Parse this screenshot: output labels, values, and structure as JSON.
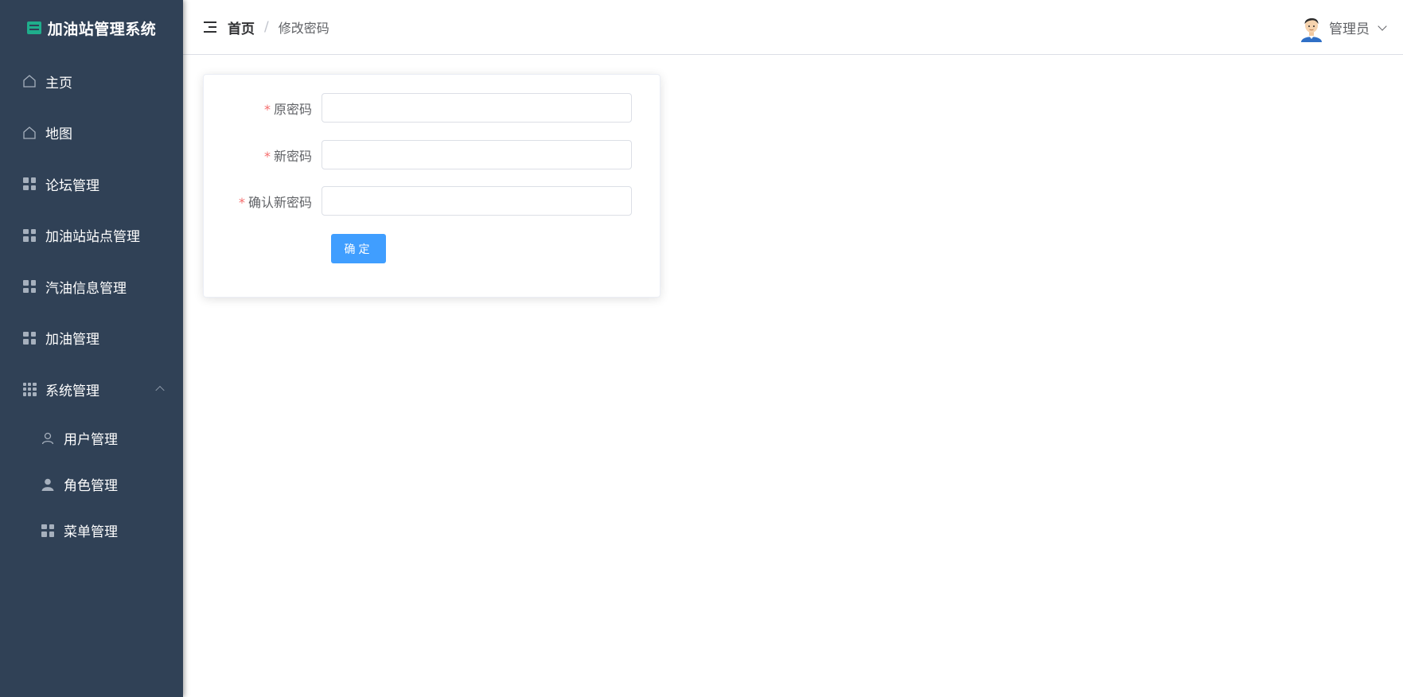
{
  "app": {
    "title": "加油站管理系统"
  },
  "sidebar": {
    "items": [
      {
        "label": "主页",
        "icon": "home-icon"
      },
      {
        "label": "地图",
        "icon": "home-icon"
      },
      {
        "label": "论坛管理",
        "icon": "grid-icon"
      },
      {
        "label": "加油站站点管理",
        "icon": "grid-icon"
      },
      {
        "label": "汽油信息管理",
        "icon": "grid-icon"
      },
      {
        "label": "加油管理",
        "icon": "grid-icon"
      },
      {
        "label": "系统管理",
        "icon": "apps-icon",
        "expanded": true,
        "children": [
          {
            "label": "用户管理",
            "icon": "user-icon"
          },
          {
            "label": "角色管理",
            "icon": "user-filled-icon"
          },
          {
            "label": "菜单管理",
            "icon": "grid-icon"
          }
        ]
      }
    ]
  },
  "header": {
    "breadcrumb": {
      "home": "首页",
      "separator": "/",
      "current": "修改密码"
    },
    "user": {
      "name": "管理员"
    }
  },
  "form": {
    "fields": [
      {
        "label": "原密码",
        "required": true,
        "value": ""
      },
      {
        "label": "新密码",
        "required": true,
        "value": ""
      },
      {
        "label": "确认新密码",
        "required": true,
        "value": ""
      }
    ],
    "submit_label": "确定"
  },
  "colors": {
    "sidebar_bg": "#304156",
    "primary": "#409eff",
    "required": "#f56c6c",
    "brand_logo": "#1fae8c"
  }
}
